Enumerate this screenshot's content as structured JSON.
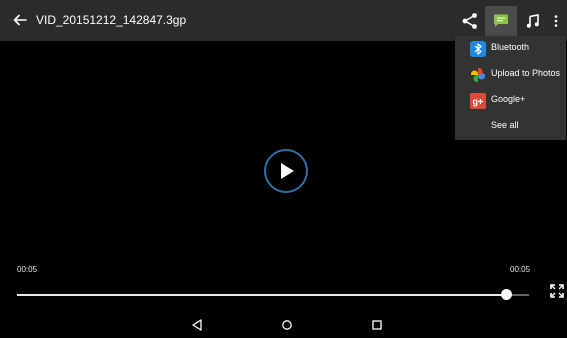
{
  "header": {
    "title": "VID_20151212_142847.3gp",
    "icons": [
      "back-arrow-icon",
      "share-icon",
      "message-icon",
      "music-icon",
      "more-vert-icon"
    ]
  },
  "share_menu": {
    "items": [
      {
        "label": "Bluetooth",
        "icon": "bluetooth-icon"
      },
      {
        "label": "Upload to Photos",
        "icon": "photos-pinwheel-icon"
      },
      {
        "label": "Google+",
        "icon": "google-plus-icon"
      },
      {
        "label": "See all",
        "icon": ""
      }
    ]
  },
  "player": {
    "current_time": "00:05",
    "total_time": "00:05",
    "progress": 0.956
  },
  "colors": {
    "play_ring": "#2f6fa5",
    "accent_green": "#8bc34a",
    "google_red": "#dd4b39",
    "bluetooth_blue": "#1e88e5"
  },
  "navbar": {
    "icons": [
      "back-triangle-icon",
      "home-circle-icon",
      "recents-square-icon"
    ]
  }
}
